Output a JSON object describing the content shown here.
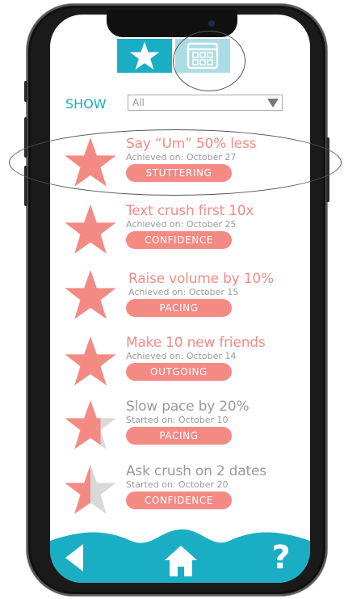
{
  "colors": {
    "accent": "#1aaec4",
    "goal_pink": "#f48a84",
    "muted_gray": "#9a9a9a",
    "star_gray": "#d9d9d9"
  },
  "header": {
    "tabs": [
      {
        "name": "achievements",
        "icon": "star-icon",
        "active": true
      },
      {
        "name": "calendar",
        "icon": "calendar-icon",
        "active": false
      }
    ]
  },
  "filter": {
    "label": "SHOW",
    "selected": "All"
  },
  "goals": [
    {
      "title": "Say “Um” 50% less",
      "date": "Achieved on: October 27",
      "tag": "STUTTERING",
      "status": "achieved",
      "progress": 1.0
    },
    {
      "title": "Text crush first 10x",
      "date": "Achieved on: October 25",
      "tag": "CONFIDENCE",
      "status": "achieved",
      "progress": 1.0
    },
    {
      "title": "Raise volume by 10%",
      "date": "Achieved on: October 15",
      "tag": "PACING",
      "status": "achieved",
      "progress": 1.0
    },
    {
      "title": "Make 10 new friends",
      "date": "Achieved on: October 14",
      "tag": "OUTGOING",
      "status": "achieved",
      "progress": 1.0
    },
    {
      "title": "Slow pace by 20%",
      "date": "Started on: October 10",
      "tag": "PACING",
      "status": "started",
      "progress": 0.7
    },
    {
      "title": "Ask crush on 2 dates",
      "date": "Started on: October 20",
      "tag": "CONFIDENCE",
      "status": "started",
      "progress": 0.5
    }
  ],
  "bottom_nav": [
    {
      "name": "back",
      "icon": "back-arrow-icon"
    },
    {
      "name": "home",
      "icon": "home-icon"
    },
    {
      "name": "help",
      "icon": "question-mark-icon",
      "label": "?"
    }
  ]
}
